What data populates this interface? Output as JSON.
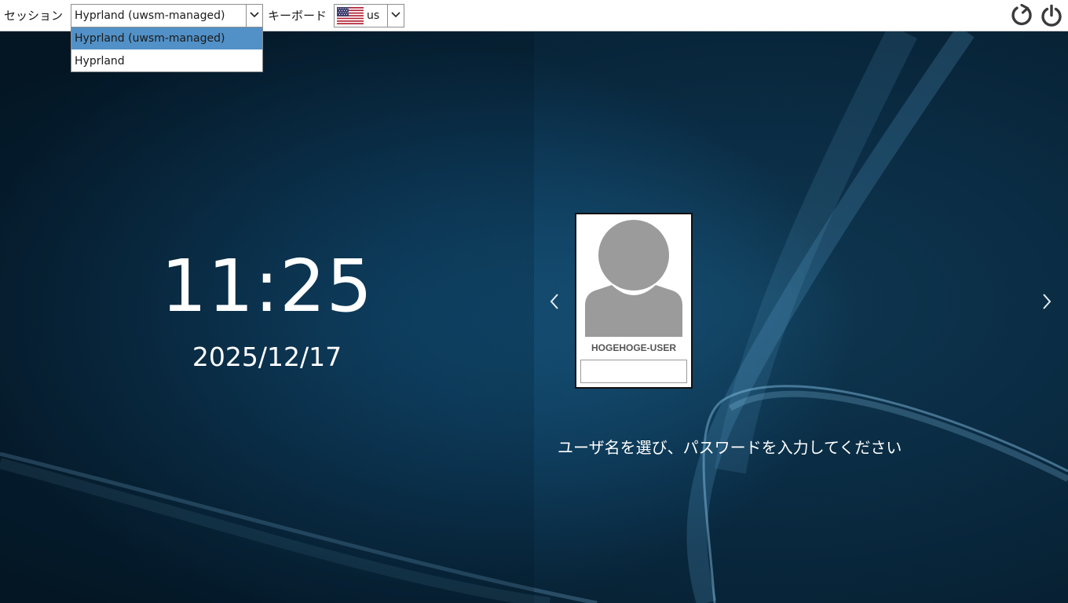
{
  "topbar": {
    "session_label": "セッション",
    "session_value": "Hyprland (uwsm-managed)",
    "keyboard_label": "キーボード",
    "keyboard_value": "us",
    "keyboard_flag_icon": "us-flag-icon",
    "reboot_icon": "reboot-icon",
    "shutdown_icon": "power-icon"
  },
  "session_dropdown": {
    "options": [
      "Hyprland (uwsm-managed)",
      "Hyprland"
    ],
    "selected_index": 0,
    "highlight_color": "#5291c7"
  },
  "clock": {
    "time": "11:25",
    "date": "2025/12/17"
  },
  "user": {
    "name": "HOGEHOGE-USER",
    "password_value": "",
    "avatar_icon": "user-avatar-icon"
  },
  "hint": "ユーザ名を選び、パスワードを入力してください",
  "colors": {
    "background": "#0b2a40",
    "accent": "#5291c7",
    "text_on_dark": "#ffffff",
    "icon_gray": "#3a3a3a"
  }
}
